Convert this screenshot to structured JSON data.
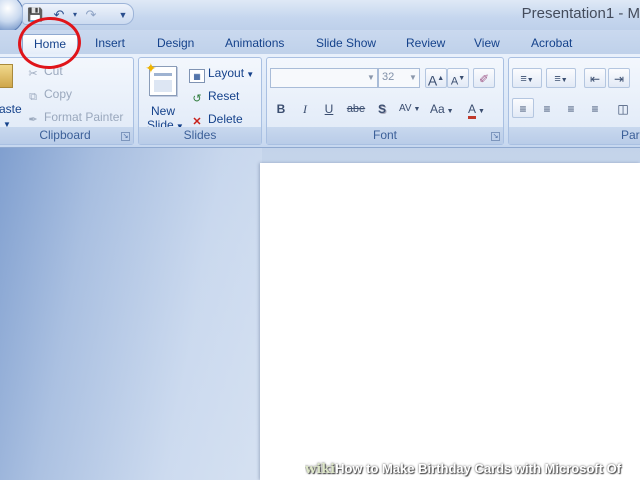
{
  "window": {
    "title": "Presentation1 - M"
  },
  "qat": {
    "icons": [
      "save-icon",
      "undo-icon",
      "redo-icon",
      "customize-icon"
    ]
  },
  "tabs": [
    {
      "label": "Home",
      "selected": true
    },
    {
      "label": "Insert"
    },
    {
      "label": "Design"
    },
    {
      "label": "Animations"
    },
    {
      "label": "Slide Show"
    },
    {
      "label": "Review"
    },
    {
      "label": "View"
    },
    {
      "label": "Acrobat"
    }
  ],
  "clipboard": {
    "paste_label": "aste",
    "cut_label": "Cut",
    "copy_label": "Copy",
    "format_painter_label": "Format Painter",
    "group_label": "Clipboard"
  },
  "slides": {
    "new_slide_label_1": "New",
    "new_slide_label_2": "Slide",
    "layout_label": "Layout",
    "reset_label": "Reset",
    "delete_label": "Delete",
    "group_label": "Slides"
  },
  "font": {
    "font_name_value": "",
    "font_size_value": "32",
    "grow_label": "A",
    "shrink_label": "A",
    "bold_label": "B",
    "italic_label": "I",
    "underline_label": "U",
    "strike_label": "abe",
    "shadow_label": "S",
    "spacing_label": "AV",
    "case_label": "Aa",
    "color_label": "A",
    "group_label": "Font"
  },
  "paragraph": {
    "group_label": "Par"
  },
  "watermark": {
    "wiki": "wiki",
    "text": "How to Make Birthday Cards with Microsoft Of"
  },
  "colors": {
    "annotation_circle": "#e0141a",
    "accent": "#15428b"
  }
}
